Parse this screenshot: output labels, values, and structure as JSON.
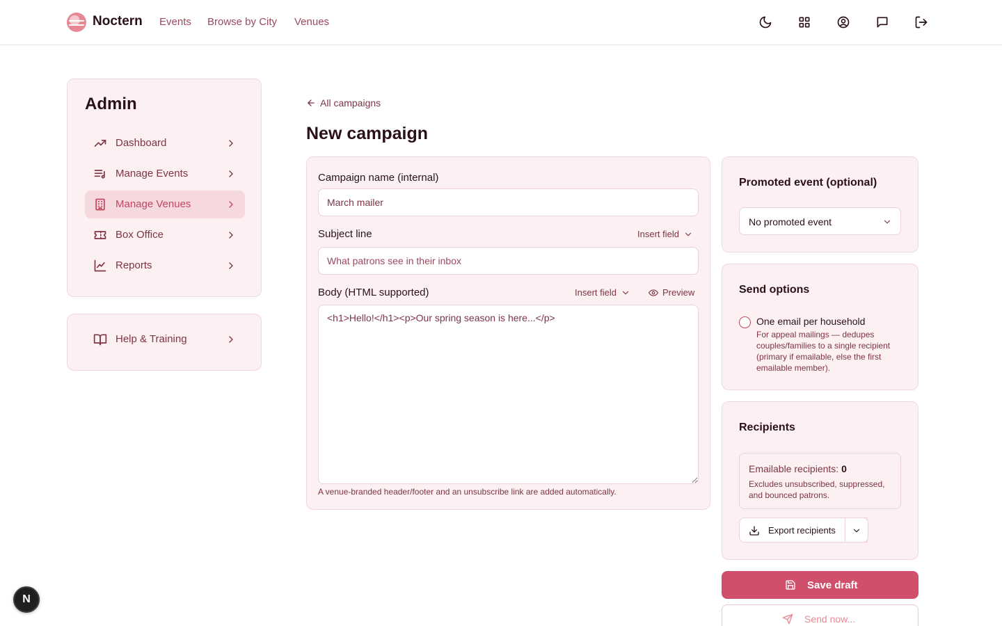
{
  "header": {
    "brand": "Noctern",
    "nav": [
      "Events",
      "Browse by City",
      "Venues"
    ],
    "icons": [
      "moon-icon",
      "grid-icon",
      "user-circle-icon",
      "message-icon",
      "logout-icon"
    ]
  },
  "sidebar": {
    "title": "Admin",
    "items": [
      {
        "label": "Dashboard",
        "icon": "trending-up-icon",
        "active": false
      },
      {
        "label": "Manage Events",
        "icon": "list-music-icon",
        "active": false
      },
      {
        "label": "Manage Venues",
        "icon": "building-icon",
        "active": true
      },
      {
        "label": "Box Office",
        "icon": "ticket-icon",
        "active": false
      },
      {
        "label": "Reports",
        "icon": "line-chart-icon",
        "active": false
      }
    ],
    "help": {
      "label": "Help & Training",
      "icon": "book-icon"
    }
  },
  "main": {
    "back_link": "All campaigns",
    "title": "New campaign",
    "form": {
      "campaign_name_label": "Campaign name (internal)",
      "campaign_name_value": "March mailer",
      "subject_label": "Subject line",
      "subject_placeholder": "What patrons see in their inbox",
      "insert_field_label": "Insert field",
      "body_label": "Body (HTML supported)",
      "preview_label": "Preview",
      "body_value": "<h1>Hello!</h1><p>Our spring season is here...</p>",
      "help_text": "A venue-branded header/footer and an unsubscribe link are added automatically."
    }
  },
  "right": {
    "promoted": {
      "title": "Promoted event (optional)",
      "selected": "No promoted event"
    },
    "send_options": {
      "title": "Send options",
      "option_label": "One email per household",
      "option_desc": "For appeal mailings — dedupes couples/families to a single recipient (primary if emailable, else the first emailable member).",
      "checked": false
    },
    "recipients": {
      "title": "Recipients",
      "emailable_label": "Emailable recipients:",
      "emailable_count": "0",
      "desc": "Excludes unsubscribed, suppressed, and bounced patrons.",
      "export_label": "Export recipients"
    },
    "save_label": "Save draft",
    "send_label": "Send now..."
  },
  "dev_badge": "N",
  "colors": {
    "accent": "#d0506b",
    "card_bg": "#fcf0f2",
    "text_muted": "#7c3446"
  }
}
